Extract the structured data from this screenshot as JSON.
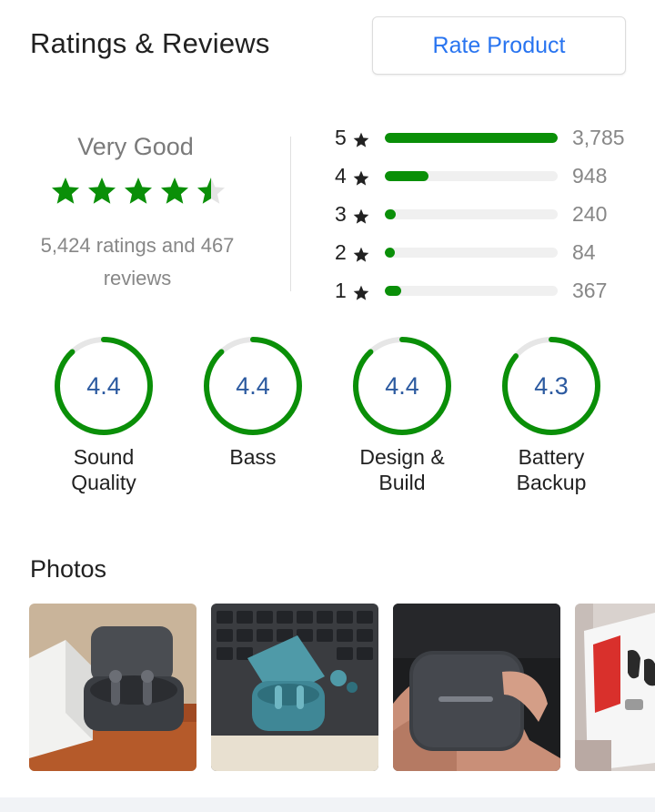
{
  "header": {
    "title": "Ratings & Reviews",
    "rate_button": "Rate Product"
  },
  "summary": {
    "verdict": "Very Good",
    "rating_stars": 4.5,
    "counts_text": "5,424 ratings and 467 reviews"
  },
  "distribution": [
    {
      "label": "5",
      "count": "3,785",
      "value": 3785
    },
    {
      "label": "4",
      "count": "948",
      "value": 948
    },
    {
      "label": "3",
      "count": "240",
      "value": 240
    },
    {
      "label": "2",
      "count": "84",
      "value": 84
    },
    {
      "label": "1",
      "count": "367",
      "value": 367
    }
  ],
  "aspects": [
    {
      "value": "4.4",
      "label_line1": "Sound",
      "label_line2": "Quality",
      "score": 4.4
    },
    {
      "value": "4.4",
      "label_line1": "Bass",
      "label_line2": "",
      "score": 4.4
    },
    {
      "value": "4.4",
      "label_line1": "Design &",
      "label_line2": "Build",
      "score": 4.4
    },
    {
      "value": "4.3",
      "label_line1": "Battery",
      "label_line2": "Backup",
      "score": 4.3
    }
  ],
  "photos": {
    "title": "Photos",
    "items": [
      "earbuds-open-case-photo",
      "teal-earbuds-on-laptop-photo",
      "charging-case-in-hand-photo",
      "earbuds-packaging-photo"
    ]
  },
  "colors": {
    "accent_blue": "#2874f0",
    "rating_green": "#0a8f08",
    "score_text_blue": "#2c5aa0"
  }
}
